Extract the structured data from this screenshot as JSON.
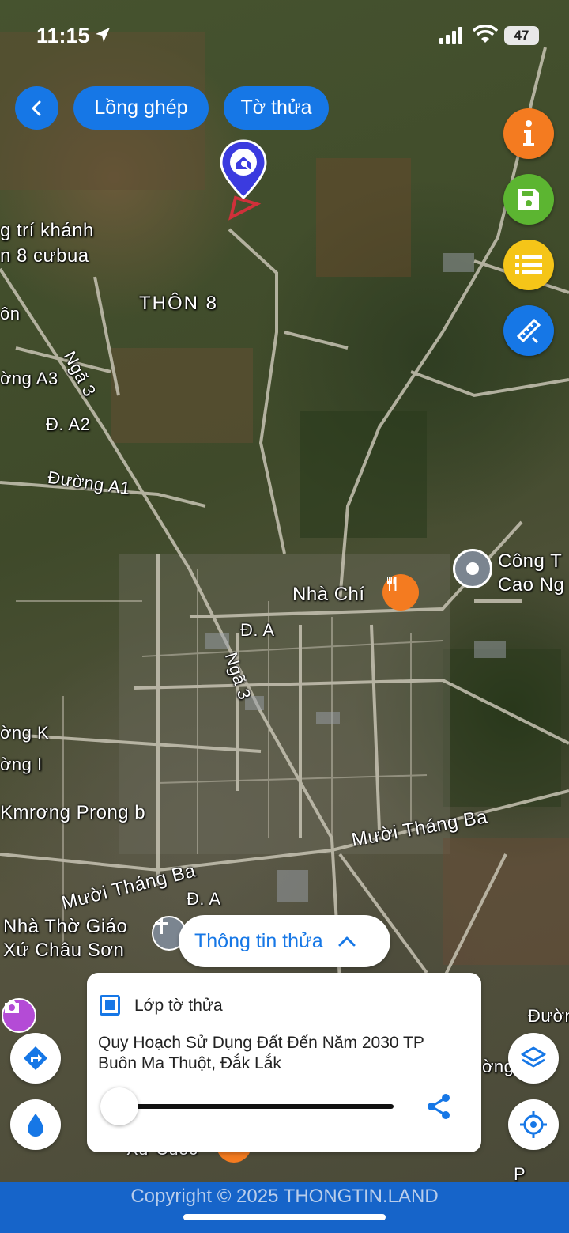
{
  "status_bar": {
    "time": "11:15",
    "battery": "47"
  },
  "toolbar": {
    "overlay_label": "Lồng ghép",
    "parcel_map_label": "Tờ thửa"
  },
  "map_labels": {
    "trikhanh": "g trí khánh",
    "thon8_cubua": "n 8 cưbua",
    "thon8": "THÔN 8",
    "on": "ôn",
    "nga3_top": "Ngã 3",
    "duong_a3": "ờng A3",
    "d_a2": "Đ. A2",
    "duong_a1": "Đường A1",
    "nha_chi": "Nhà Chí",
    "cong_ty_1": "Công T",
    "cong_ty_2": "Cao Ng",
    "d_a_mid": "Đ. A",
    "nga3_mid": "Ngã 3",
    "duong_k": "ờng K",
    "duong_i": "ờng I",
    "kmrong": "Kmrơng Prong b",
    "muoi_thang_ba_right": "Mười Tháng Ba",
    "muoi_thang_ba_left": "Mười Tháng Ba",
    "d_a_low": "Đ. A",
    "nha_tho_1": "Nhà Thờ Giáo",
    "nha_tho_2": "Xứ Châu Sơn",
    "duong_right": "Đườn",
    "rong_right": "ờng",
    "p_right": "P",
    "xa_cuoc": "Xứ Cuốc"
  },
  "bottom": {
    "info_tab_label": "Thông tin thửa",
    "layer_label": "Lớp tờ thửa",
    "plan_title": "Quy Hoạch Sử Dụng Đất Đến Năm 2030 TP Buôn Ma Thuột, Đắk Lắk",
    "opacity_value": 0
  },
  "footer": {
    "copyright": "Copyright © 2025 THONGTIN.LAND"
  },
  "colors": {
    "primary": "#1677e6",
    "info": "#f47b20",
    "save": "#5cb531",
    "list": "#f5c518",
    "footer": "#1664c9"
  }
}
